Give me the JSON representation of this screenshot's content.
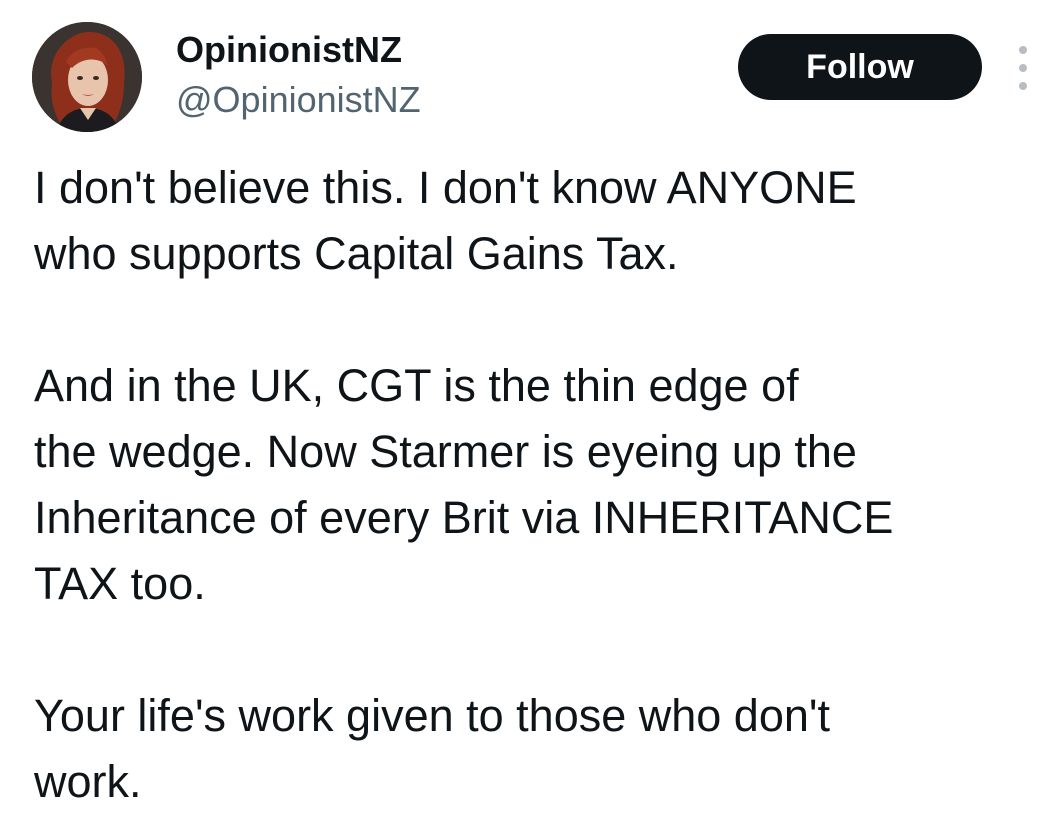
{
  "author": {
    "display_name": "OpinionistNZ",
    "handle": "@OpinionistNZ",
    "avatar_icon": "profile-photo"
  },
  "actions": {
    "follow_label": "Follow",
    "more_icon": "more-vertical-icon"
  },
  "tweet": {
    "paragraphs": [
      "I don't believe this. I don't know ANYONE\nwho supports Capital Gains Tax.",
      "And in the UK, CGT is the thin edge of\nthe wedge. Now Starmer is eyeing up the\nInheritance of every Brit via INHERITANCE\nTAX too.",
      "Your life's work given to those who don't\nwork."
    ]
  },
  "colors": {
    "text_primary": "#0f1419",
    "text_secondary": "#536471",
    "follow_bg": "#0f1419",
    "follow_text": "#ffffff",
    "more_dots": "#b7bdc2"
  }
}
